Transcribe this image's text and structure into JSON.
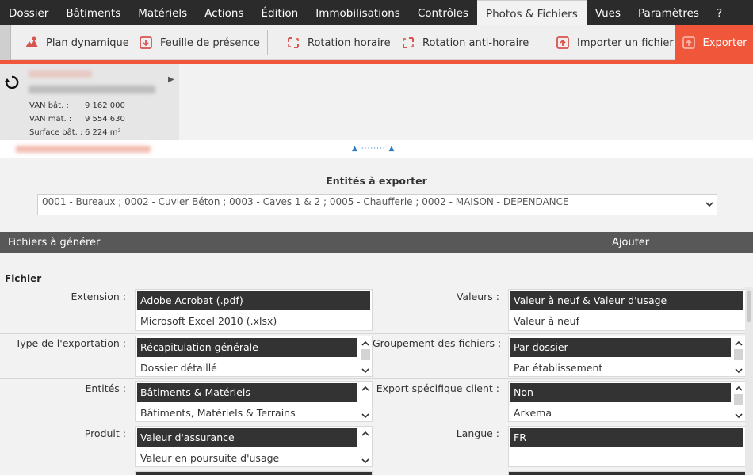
{
  "menu": {
    "tabs": [
      "Dossier",
      "Bâtiments",
      "Matériels",
      "Actions",
      "Édition",
      "Immobilisations",
      "Contrôles",
      "Photos & Fichiers",
      "Vues",
      "Paramètres",
      "?"
    ],
    "active_index": 7
  },
  "toolbar": {
    "plan_label": "Plan dynamique",
    "presence_label": "Feuille de présence",
    "rotation_cw_label": "Rotation horaire",
    "rotation_ccw_label": "Rotation anti-horaire",
    "import_label": "Importer un fichier",
    "export_label": "Exporter"
  },
  "info": {
    "van_bat_label": "VAN bât. :",
    "van_bat_value": "9 162 000",
    "van_mat_label": "VAN mat. :",
    "van_mat_value": "9 554 630",
    "surface_label": "Surface bât. :",
    "surface_value": "6 224 m²"
  },
  "entities": {
    "title": "Entités à exporter",
    "selected": "0001 - Bureaux ; 0002 - Cuvier Béton ; 0003 - Caves 1 & 2 ; 0005 - Chaufferie ; 0002 - MAISON - DEPENDANCE"
  },
  "files_bar": {
    "title": "Fichiers à générer",
    "add_label": "Ajouter"
  },
  "fichier": {
    "section_title": "Fichier",
    "extension": {
      "label": "Extension :",
      "options": [
        "Adobe Acrobat (.pdf)",
        "Microsoft Excel 2010 (.xlsx)"
      ]
    },
    "valeurs": {
      "label": "Valeurs :",
      "options": [
        "Valeur à neuf & Valeur d'usage",
        "Valeur à neuf"
      ]
    },
    "type_export": {
      "label": "Type de l'exportation :",
      "options": [
        "Récapitulation générale",
        "Dossier détaillé"
      ]
    },
    "groupement": {
      "label": "Groupement des fichiers :",
      "options": [
        "Par dossier",
        "Par établissement"
      ]
    },
    "entites": {
      "label": "Entités :",
      "options": [
        "Bâtiments & Matériels",
        "Bâtiments, Matériels & Terrains"
      ]
    },
    "export_specifique": {
      "label": "Export spécifique client :",
      "options": [
        "Non",
        "Arkema"
      ]
    },
    "produit": {
      "label": "Produit :",
      "options": [
        "Valeur d'assurance",
        "Valeur en poursuite d'usage"
      ]
    },
    "langue": {
      "label": "Langue :",
      "options": [
        "FR"
      ]
    }
  },
  "colors": {
    "accent": "#f0563a",
    "menu_bg": "#2b2b2b",
    "section_bar": "#585858",
    "selected_option": "#333333"
  }
}
